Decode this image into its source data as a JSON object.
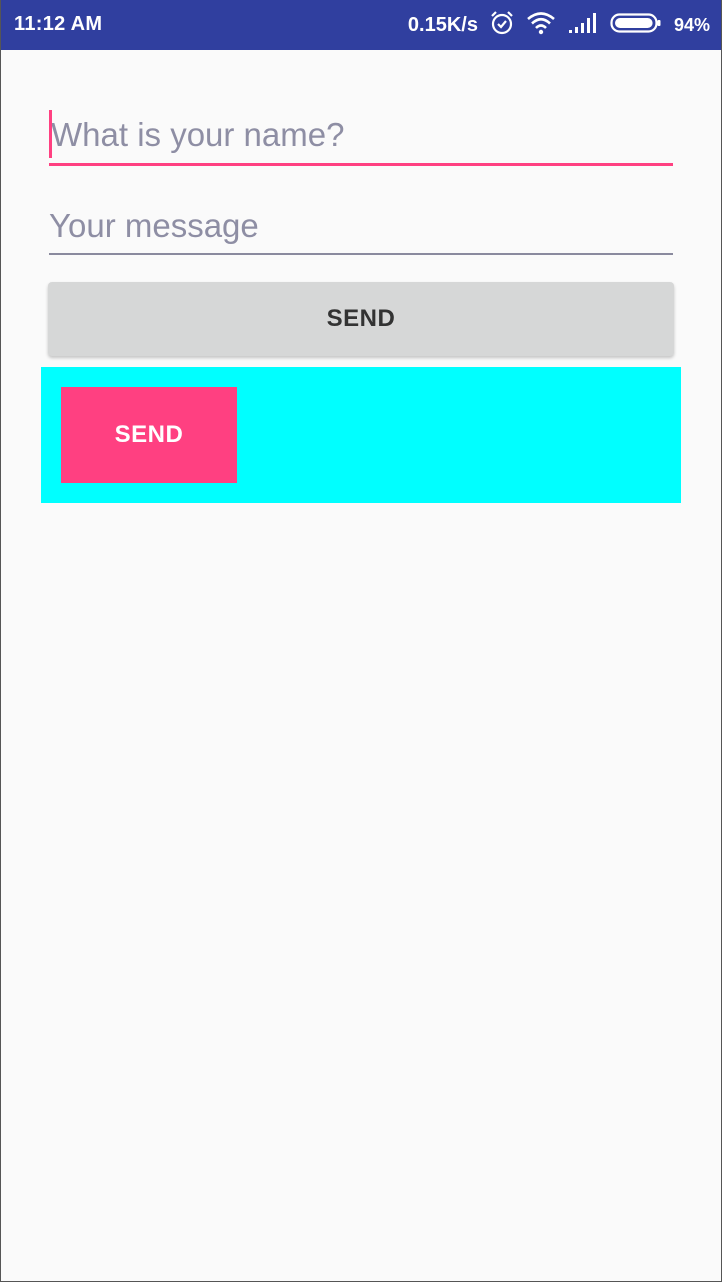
{
  "status_bar": {
    "time": "11:12 AM",
    "net_speed": "0.15K/s",
    "battery_percent": "94%",
    "battery_level": 0.94,
    "icons": [
      "alarm-icon",
      "wifi-icon",
      "signal-icon",
      "battery-icon"
    ],
    "background_color": "#303f9f"
  },
  "form": {
    "name_field": {
      "placeholder": "What is your name?",
      "value": ""
    },
    "message_field": {
      "placeholder": "Your message",
      "value": ""
    },
    "send_button_label": "SEND",
    "accent_color": "#ff4081"
  },
  "custom_panel": {
    "background_color": "#00ffff",
    "send_button_label": "SEND"
  }
}
